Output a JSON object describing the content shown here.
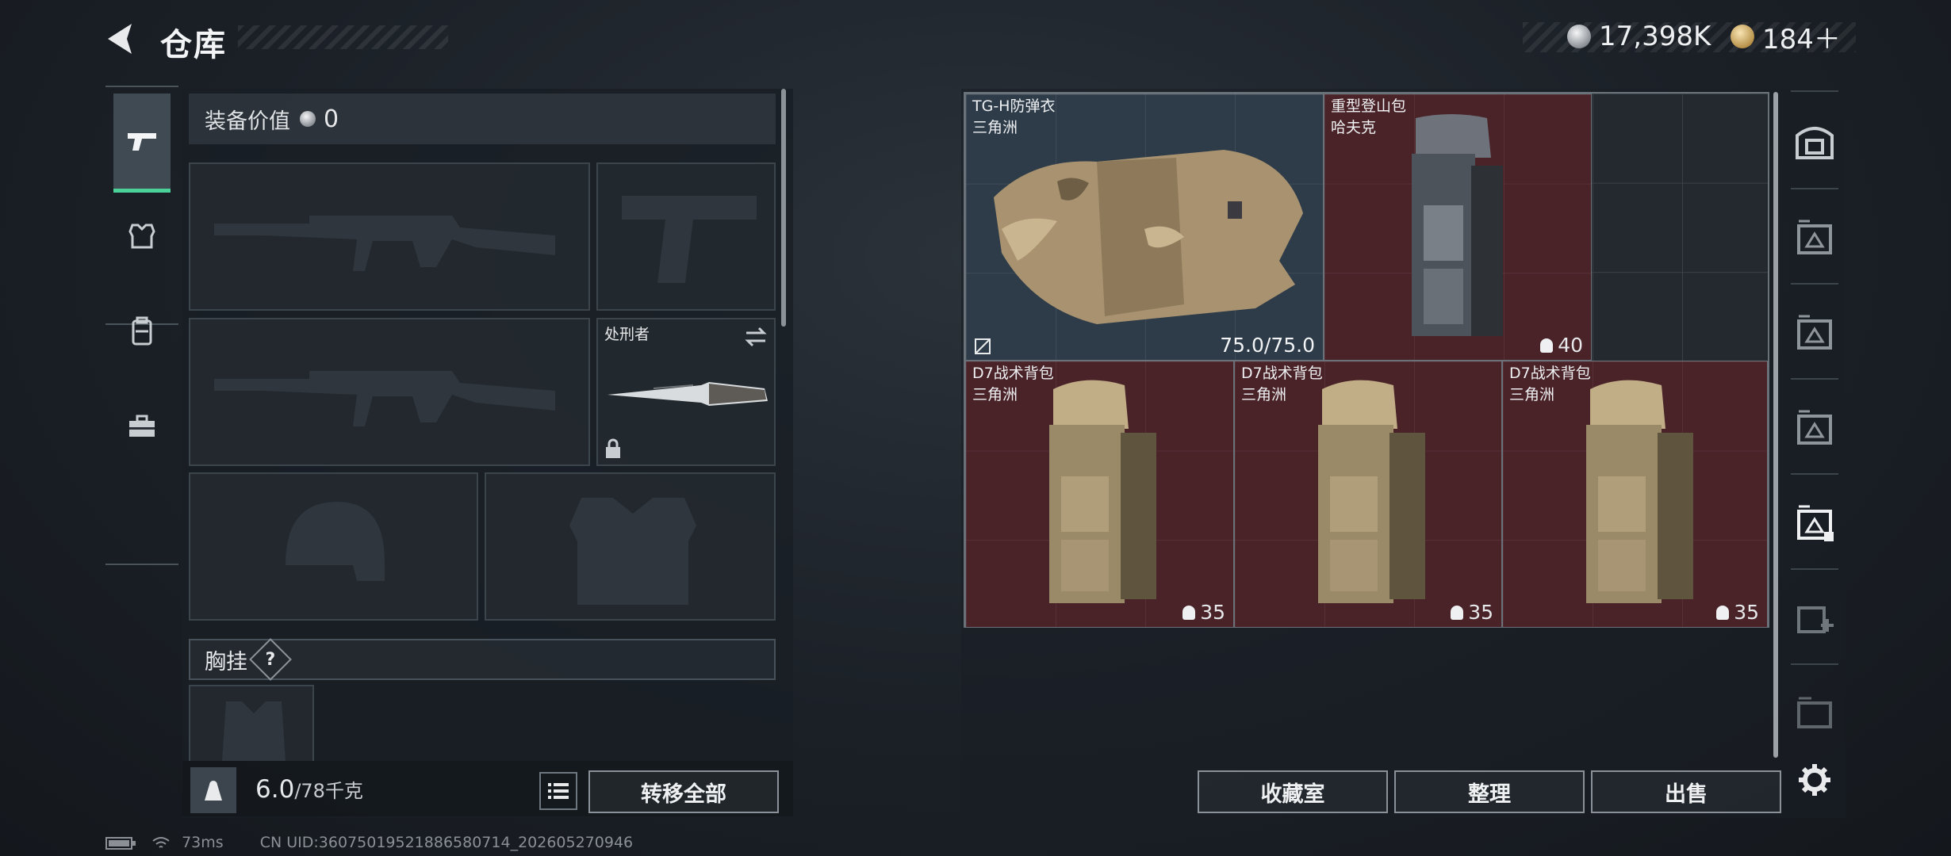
{
  "header": {
    "title": "仓库",
    "currency1": "17,398K",
    "currency2": "184＋"
  },
  "nav": {
    "items": [
      "weapons",
      "armor",
      "backpack",
      "toolbox"
    ]
  },
  "loadout": {
    "value_label": "装备价值",
    "value": "0",
    "melee_name": "处刑者",
    "chest_label": "胸挂",
    "chest_help": "?",
    "weight_value": "6.0",
    "weight_max": "/78千克",
    "transfer_all": "转移全部"
  },
  "storage": {
    "items": [
      {
        "name": "TG-H防弹衣",
        "sub": "三角洲",
        "durability": "75.0/75.0"
      },
      {
        "name": "重型登山包",
        "sub": "哈夫克",
        "capacity": "40"
      },
      {
        "name": "D7战术背包",
        "sub": "三角洲",
        "capacity": "35"
      },
      {
        "name": "D7战术背包",
        "sub": "三角洲",
        "capacity": "35"
      },
      {
        "name": "D7战术背包",
        "sub": "三角洲",
        "capacity": "35"
      }
    ],
    "buttons": {
      "collection": "收藏室",
      "sort": "整理",
      "sell": "出售"
    }
  },
  "footer": {
    "ping": "73ms",
    "uid": "CN UID:36075019521886580714_202605270946"
  },
  "colors": {
    "accent": "#4ad29a",
    "item_blue": "#2e3c49",
    "item_red": "#4a2329"
  },
  "icons": [
    "back-arrow-icon",
    "silver-coin-icon",
    "gold-coin-icon",
    "pistol-icon",
    "armor-icon",
    "backpack-icon",
    "toolbox-icon",
    "swap-icon",
    "lock-icon",
    "list-icon",
    "weight-icon",
    "settings-icon",
    "safe-icon",
    "storage-icon"
  ]
}
